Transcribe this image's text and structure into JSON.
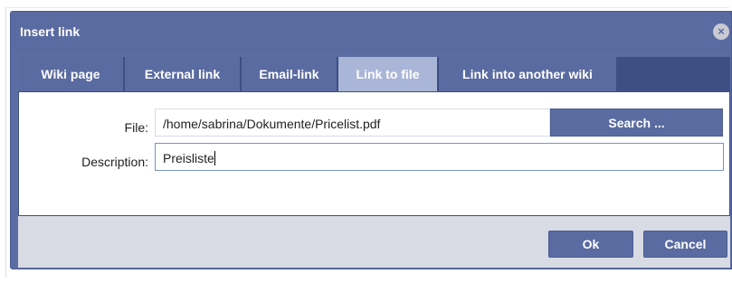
{
  "dialog": {
    "title": "Insert link",
    "close_icon": "close-icon"
  },
  "tabs": [
    {
      "label": "Wiki page",
      "active": false
    },
    {
      "label": "External link",
      "active": false
    },
    {
      "label": "Email-link",
      "active": false
    },
    {
      "label": "Link to file",
      "active": true
    },
    {
      "label": "Link into another wiki",
      "active": false
    }
  ],
  "form": {
    "file_label": "File:",
    "file_value": "/home/sabrina/Dokumente/Pricelist.pdf",
    "search_button": "Search ...",
    "description_label": "Description:",
    "description_value": "Preisliste"
  },
  "footer": {
    "ok_label": "Ok",
    "cancel_label": "Cancel"
  },
  "colors": {
    "titlebar": "#5a6ba1",
    "tab_active": "#aab6d8",
    "footer": "#d8dbe4"
  }
}
